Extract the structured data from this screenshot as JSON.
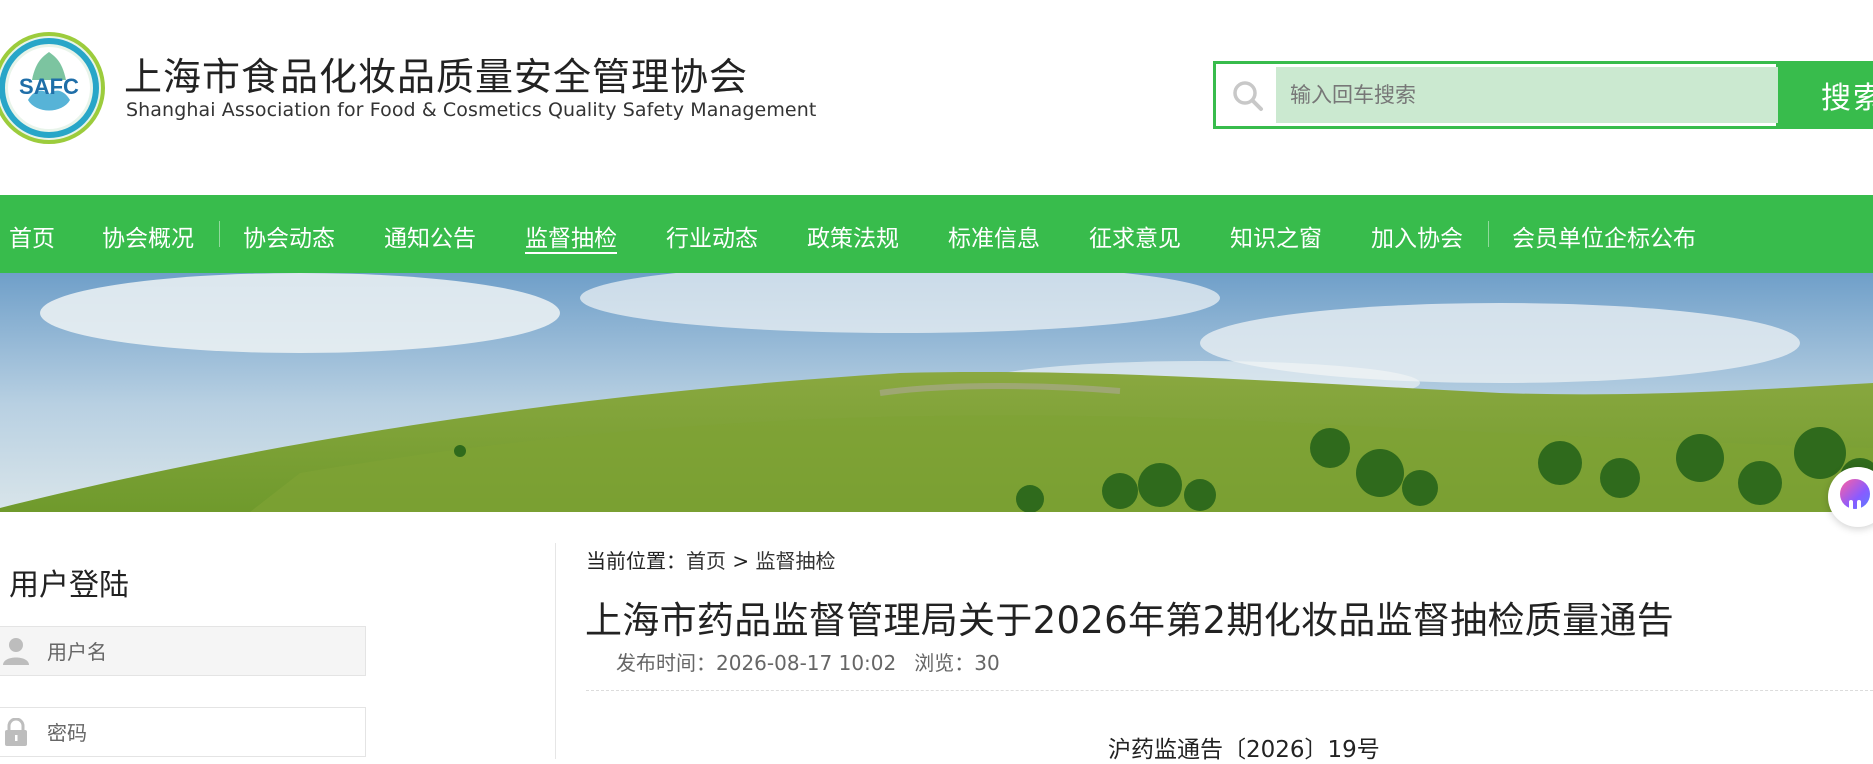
{
  "header": {
    "title_cn": "上海市食品化妆品质量安全管理协会",
    "title_en": "Shanghai Association for Food & Cosmetics Quality Safety Management",
    "logo_text": "SAFC",
    "search_placeholder": "输入回车搜索",
    "search_button": "搜索"
  },
  "nav": {
    "items": [
      {
        "label": "首页"
      },
      {
        "label": "协会概况"
      },
      {
        "label": "协会动态"
      },
      {
        "label": "通知公告"
      },
      {
        "label": "监督抽检"
      },
      {
        "label": "行业动态"
      },
      {
        "label": "政策法规"
      },
      {
        "label": "标准信息"
      },
      {
        "label": "征求意见"
      },
      {
        "label": "知识之窗"
      },
      {
        "label": "加入协会"
      },
      {
        "label": "会员单位企标公布"
      }
    ],
    "active": "监督抽检"
  },
  "sidebar": {
    "login_title": "用户登陆",
    "username_placeholder": "用户名",
    "password_placeholder": "密码"
  },
  "content": {
    "breadcrumb": {
      "prefix": "当前位置：",
      "home": "首页",
      "separator": " > ",
      "current": "监督抽检"
    },
    "title": "上海市药品监督管理局关于2026年第2期化妆品监督抽检质量通告",
    "meta": {
      "published_label": "发布时间：",
      "published": "2026-08-17 10:02",
      "views_label": "浏览：",
      "views": "30"
    },
    "doc_number": "沪药监通告〔2026〕19号"
  },
  "colors": {
    "brand_green": "#38bc4c",
    "search_fill": "#cbe9d0"
  }
}
